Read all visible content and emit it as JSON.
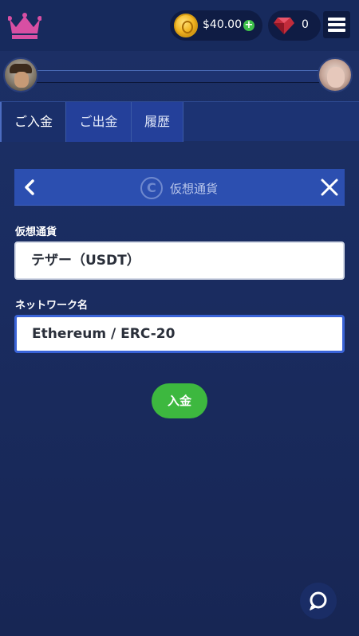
{
  "header": {
    "balance": "$40.00",
    "gems": "0"
  },
  "tabs": [
    {
      "label": "ご入金",
      "active": true
    },
    {
      "label": "ご出金",
      "active": false
    },
    {
      "label": "履歴",
      "active": false
    }
  ],
  "panel": {
    "title": "仮想通貨"
  },
  "form": {
    "currency_label": "仮想通貨",
    "currency_value": "テザー（USDT）",
    "network_label": "ネットワーク名",
    "network_value": "Ethereum / ERC-20",
    "submit_label": "入金"
  },
  "colors": {
    "background": "#1c3066",
    "accent_green": "#3db83f",
    "panel_blue": "#2c4fb0",
    "crown": "#d84fa3"
  },
  "icons": [
    "crown-icon",
    "coin-icon",
    "plus-icon",
    "gem-icon",
    "menu-icon",
    "chevron-left-icon",
    "crypto-icon",
    "close-icon",
    "chat-icon"
  ]
}
